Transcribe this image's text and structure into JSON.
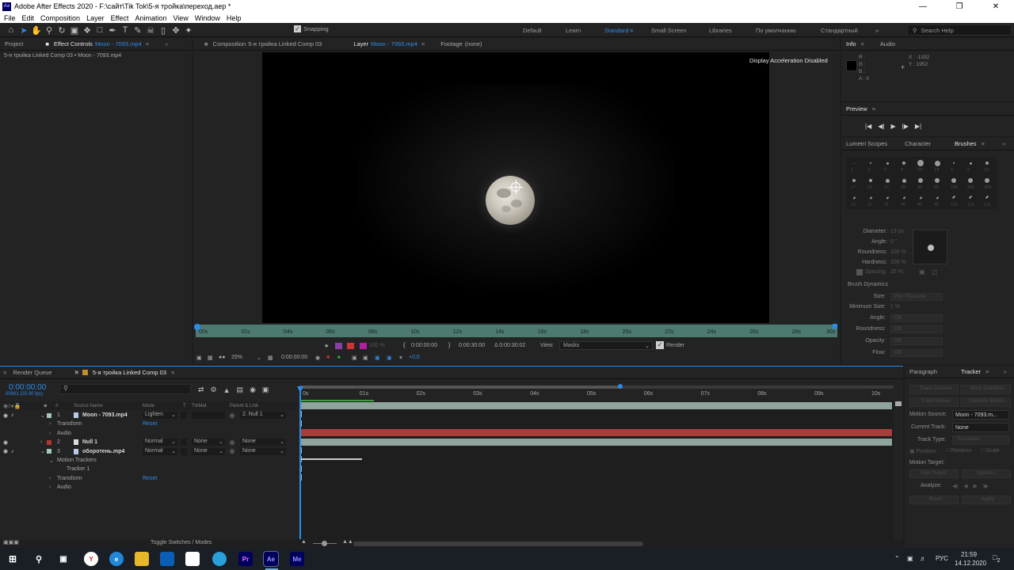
{
  "window": {
    "title": "Adobe After Effects 2020 - F:\\сайт\\Tik Tok\\5-я тройка\\переход.aep *",
    "app_icon": "Ae",
    "controls": [
      "minimize-icon",
      "maximize-icon",
      "close-icon"
    ]
  },
  "menu": [
    "File",
    "Edit",
    "Composition",
    "Layer",
    "Effect",
    "Animation",
    "View",
    "Window",
    "Help"
  ],
  "toolbar": {
    "snapping_label": "Snapping",
    "snapping_checked": true,
    "workspaces": [
      "Default",
      "Learn",
      "Standard",
      "Small Screen",
      "Libraries",
      "По умолчанию",
      "Стандартный"
    ],
    "active_workspace": "Standard",
    "search_placeholder": "Search Help"
  },
  "left_panel": {
    "project_tab": "Project",
    "effect_controls_tab": "Effect Controls",
    "effect_controls_layer": "Moon - 7093.mp4",
    "breadcrumb": "5-я тройка Linked Comp 03 • Moon - 7093.mp4"
  },
  "viewer_tabs": {
    "composition_tab": "Composition",
    "composition_name": "5-я тройка Linked Comp 03",
    "layer_tab": "Layer",
    "layer_name": "Moon - 7093.mp4",
    "footage_tab": "Footage",
    "footage_value": "(none)",
    "display_notice": "Display Acceleration Disabled"
  },
  "layer_ruler": {
    "ticks": [
      "00s",
      "02s",
      "04s",
      "06s",
      "08s",
      "10s",
      "12s",
      "14s",
      "16s",
      "18s",
      "20s",
      "22s",
      "24s",
      "26s",
      "28s",
      "30s"
    ]
  },
  "layer_footer": {
    "opacity": "100 %",
    "in_time": "0:00:00:00",
    "out_time": "0:00:30:00",
    "duration": "Δ 0:00:30:02",
    "view_label": "View:",
    "view_value": "Masks",
    "render_label": "Render",
    "render_checked": true
  },
  "viewer_bottom": {
    "zoom": "25%",
    "current_time": "0:00:00:00",
    "exposure": "+0,0"
  },
  "info_panel": {
    "tab": "Info",
    "audio_tab": "Audio",
    "r_label": "R :",
    "g_label": "G :",
    "b_label": "B :",
    "a_label": "A : 0",
    "x_readout": "X : -1332",
    "y_readout": "Y : 1952"
  },
  "preview_panel": {
    "tab": "Preview",
    "controls": [
      "first-frame-icon",
      "prev-frame-icon",
      "play-icon",
      "next-frame-icon",
      "last-frame-icon"
    ]
  },
  "brushes_panel": {
    "tabs": [
      "Lumetri Scopes",
      "Character",
      "Brushes"
    ],
    "active_tab": "Brushes",
    "brush_sizes": [
      "1",
      "3",
      "5",
      "9",
      "20",
      "14",
      "5",
      "9",
      "13",
      "17",
      "21",
      "27",
      "35",
      "45",
      "65",
      "100",
      "200",
      "300",
      "12",
      "11",
      "31",
      "45",
      "45",
      "45",
      "131",
      "131",
      "131"
    ],
    "diameter_label": "Diameter:",
    "diameter_value": "13 px",
    "angle_label": "Angle:",
    "angle_value": "0 °",
    "roundness_label": "Roundness:",
    "roundness_value": "100 %",
    "hardness_label": "Hardness:",
    "hardness_value": "100 %",
    "spacing_label": "Spacing:",
    "spacing_value": "25 %",
    "dynamics_title": "Brush Dynamics",
    "size_label": "Size:",
    "size_value": "Pen Pressure",
    "min_size_label": "Minimum Size:",
    "min_size_value": "1 %",
    "dyn_angle_label": "Angle:",
    "dyn_angle_value": "Off",
    "dyn_roundness_label": "Roundness:",
    "dyn_roundness_value": "Off",
    "opacity_label": "Opacity:",
    "opacity_value": "Off",
    "flow_label": "Flow:",
    "flow_value": "Off"
  },
  "timeline": {
    "render_queue_tab": "Render Queue",
    "comp_tab": "5-я тройка Linked Comp 03",
    "timecode": "0:00:00:00",
    "frame_info": "00001 (25.00 fps)",
    "columns": {
      "num": "#",
      "source": "Source Name",
      "mode": "Mode",
      "t": "T",
      "trkmat": "TrkMat",
      "parent": "Parent & Link"
    },
    "ruler_ticks": [
      "0s",
      "01s",
      "02s",
      "03s",
      "04s",
      "05s",
      "06s",
      "07s",
      "08s",
      "09s",
      "10s"
    ],
    "layers": [
      {
        "num": "1",
        "name": "Moon - 7093.mp4",
        "mode": "Lighten",
        "trkmat": "",
        "parent": "2. Null 1",
        "color": "#a4c7bf",
        "bar_color": "#8ea49c"
      },
      {
        "num": "2",
        "name": "Null 1",
        "mode": "Normal",
        "trkmat": "None",
        "parent": "None",
        "color": "#b3362e",
        "bar_color": "#a63f3a"
      },
      {
        "num": "3",
        "name": "оборотень.mp4",
        "mode": "Normal",
        "trkmat": "None",
        "parent": "None",
        "color": "#a4c7bf",
        "bar_color": "#8ea49c"
      }
    ],
    "sub_rows": [
      {
        "label": "Transform",
        "value": "Reset"
      },
      {
        "label": "Audio",
        "value": ""
      },
      {
        "label": "Motion Trackers",
        "value": ""
      },
      {
        "label": "Tracker 1",
        "value": ""
      },
      {
        "label": "Transform",
        "value": "Reset"
      },
      {
        "label": "Audio",
        "value": ""
      }
    ],
    "toggle_label": "Toggle Switches / Modes"
  },
  "tracker_panel": {
    "paragraph_tab": "Paragraph",
    "tracker_tab": "Tracker",
    "track_camera": "Track Camera",
    "warp_stabilizer": "Warp Stabilizer",
    "track_motion": "Track Motion",
    "stabilize_motion": "Stabilize Motion",
    "motion_source_label": "Motion Source:",
    "motion_source_value": "Moon - 7093.m...",
    "current_track_label": "Current Track:",
    "current_track_value": "None",
    "track_type_label": "Track Type:",
    "track_type_value": "Transform",
    "position_label": "Position",
    "rotation_label": "Rotation",
    "scale_label": "Scale",
    "motion_target_label": "Motion Target:",
    "edit_target": "Edit Target...",
    "options": "Options...",
    "analyze_label": "Analyze:",
    "reset": "Reset",
    "apply": "Apply"
  },
  "taskbar": {
    "apps": [
      "Y",
      "e",
      "",
      "",
      "",
      "",
      "Pr",
      "Ae",
      "Me"
    ],
    "lang": "РУС",
    "time": "21:59",
    "date": "14.12.2020",
    "notifications": "2"
  }
}
